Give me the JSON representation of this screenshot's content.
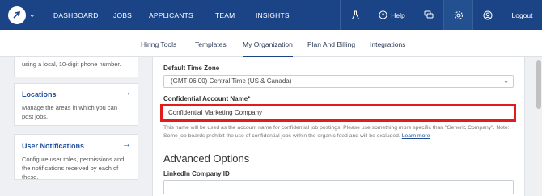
{
  "topnav": {
    "links": [
      "DASHBOARD",
      "JOBS",
      "APPLICANTS",
      "TEAM",
      "INSIGHTS"
    ],
    "help_label": "Help",
    "logout_label": "Logout"
  },
  "subnav": {
    "items": [
      "Hiring Tools",
      "Templates",
      "My Organization",
      "Plan And Billing",
      "Integrations"
    ],
    "active": "My Organization"
  },
  "sidebar": {
    "top_card_desc": "using a local, 10-digit phone number.",
    "cards": [
      {
        "title": "Locations",
        "desc": "Manage the areas in which you can post jobs."
      },
      {
        "title": "User Notifications",
        "desc": "Configure user roles, permissions and the notifications received by each of these."
      }
    ]
  },
  "form": {
    "timezone_label": "Default Time Zone",
    "timezone_value": "(GMT-06:00) Central Time (US & Canada)",
    "confidential_label": "Confidential Account Name*",
    "confidential_value": "Confidential Marketing Company",
    "help_text": "This name will be used as the account name for confidential job postings. Please use something more specific than \"Generic Company\". Note: Some job boards prohibit the use of confidential jobs within the organic feed and will be excluded.",
    "learn_more": "Learn more",
    "advanced_title": "Advanced Options",
    "linkedin_label": "LinkedIn Company ID",
    "linkedin_value": ""
  },
  "colors": {
    "nav_bg": "#1a4485",
    "highlight": "#e21b1b",
    "link": "#1f4f9c"
  },
  "icons": [
    "app-logo-icon",
    "chevron-down-icon",
    "flask-icon",
    "help-icon",
    "chat-icon",
    "gear-icon",
    "user-icon",
    "arrow-right-icon"
  ]
}
